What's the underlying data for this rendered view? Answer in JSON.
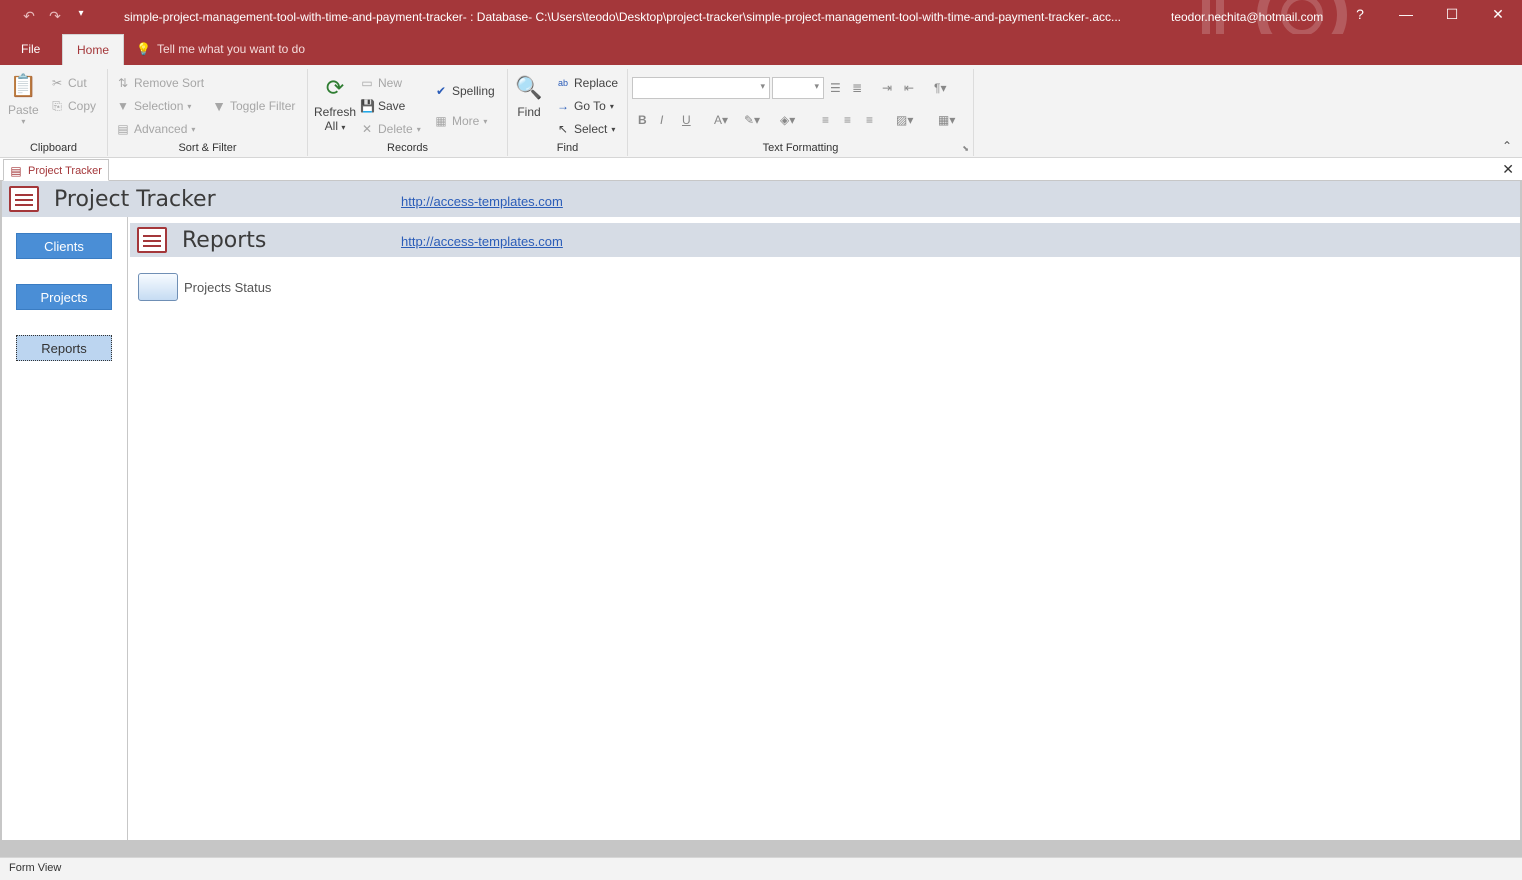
{
  "window": {
    "title": "simple-project-management-tool-with-time-and-payment-tracker- : Database- C:\\Users\\teodo\\Desktop\\project-tracker\\simple-project-management-tool-with-time-and-payment-tracker-.acc...",
    "account": "teodor.nechita@hotmail.com",
    "help": "?",
    "minimize": "—",
    "maximize": "☐",
    "close": "✕"
  },
  "ribbon_tabs": {
    "file": "File",
    "home": "Home",
    "tell_me": "Tell me what you want to do"
  },
  "clipboard": {
    "label": "Clipboard",
    "paste": "Paste",
    "cut": "Cut",
    "copy": "Copy"
  },
  "sort_filter": {
    "label": "Sort & Filter",
    "remove_sort": "Remove Sort",
    "selection": "Selection",
    "advanced": "Advanced",
    "toggle_filter": "Toggle Filter"
  },
  "records": {
    "label": "Records",
    "refresh": "Refresh",
    "refresh_all": "All",
    "new": "New",
    "save": "Save",
    "delete": "Delete",
    "spelling": "Spelling",
    "more": "More"
  },
  "find": {
    "label": "Find",
    "find": "Find",
    "replace": "Replace",
    "goto": "Go To",
    "select": "Select"
  },
  "text_formatting": {
    "label": "Text Formatting",
    "bold": "B",
    "italic": "I",
    "underline": "U"
  },
  "doc_tab": {
    "label": "Project Tracker",
    "close": "✕"
  },
  "form": {
    "title": "Project Tracker",
    "link": "http://access-templates.com",
    "nav": {
      "clients": "Clients",
      "projects": "Projects",
      "reports": "Reports"
    },
    "subform_title": "Reports",
    "subform_link": "http://access-templates.com",
    "report_item": "Projects Status"
  },
  "status": {
    "view": "Form View"
  },
  "colors": {
    "accent": "#a4373a",
    "nav_button": "#4a8ed6",
    "header_band": "#d6dce5",
    "link": "#2a5cb8"
  }
}
